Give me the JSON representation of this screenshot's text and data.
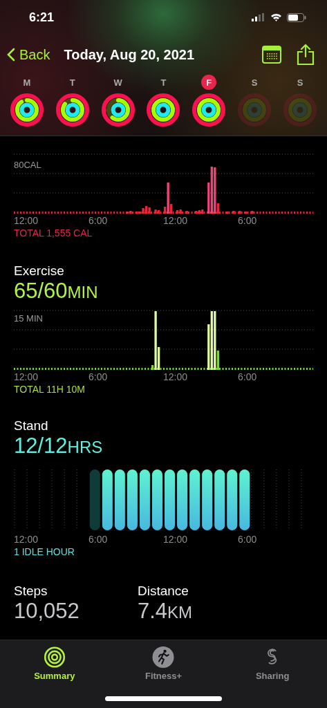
{
  "status_bar": {
    "time": "6:21"
  },
  "nav": {
    "back": "Back",
    "title": "Today, Aug 20, 2021"
  },
  "days": [
    {
      "letter": "M",
      "selected": false
    },
    {
      "letter": "T",
      "selected": false
    },
    {
      "letter": "W",
      "selected": false
    },
    {
      "letter": "T",
      "selected": false
    },
    {
      "letter": "F",
      "selected": true
    },
    {
      "letter": "S",
      "selected": false
    },
    {
      "letter": "S",
      "selected": false
    }
  ],
  "move": {
    "scale": "80CAL",
    "times": [
      "12:00",
      "6:00",
      "12:00",
      "6:00"
    ],
    "total": "TOTAL 1,555 CAL"
  },
  "exercise": {
    "title": "Exercise",
    "value": "65/60",
    "unit": "MIN",
    "scale": "15 MIN",
    "times": [
      "12:00",
      "6:00",
      "12:00",
      "6:00"
    ],
    "total": "TOTAL 11H 10M"
  },
  "stand": {
    "title": "Stand",
    "value": "12/12",
    "unit": "HRS",
    "times": [
      "12:00",
      "6:00",
      "12:00",
      "6:00"
    ],
    "total": "1 IDLE HOUR"
  },
  "stats": [
    {
      "label": "Steps",
      "value": "10,052"
    },
    {
      "label": "Distance",
      "value": "7.4",
      "unit": "KM"
    }
  ],
  "tabs": [
    {
      "label": "Summary",
      "kind": "rings",
      "selected": true
    },
    {
      "label": "Fitness+",
      "kind": "runner",
      "selected": false
    },
    {
      "label": "Sharing",
      "kind": "sharing",
      "selected": false
    }
  ]
}
